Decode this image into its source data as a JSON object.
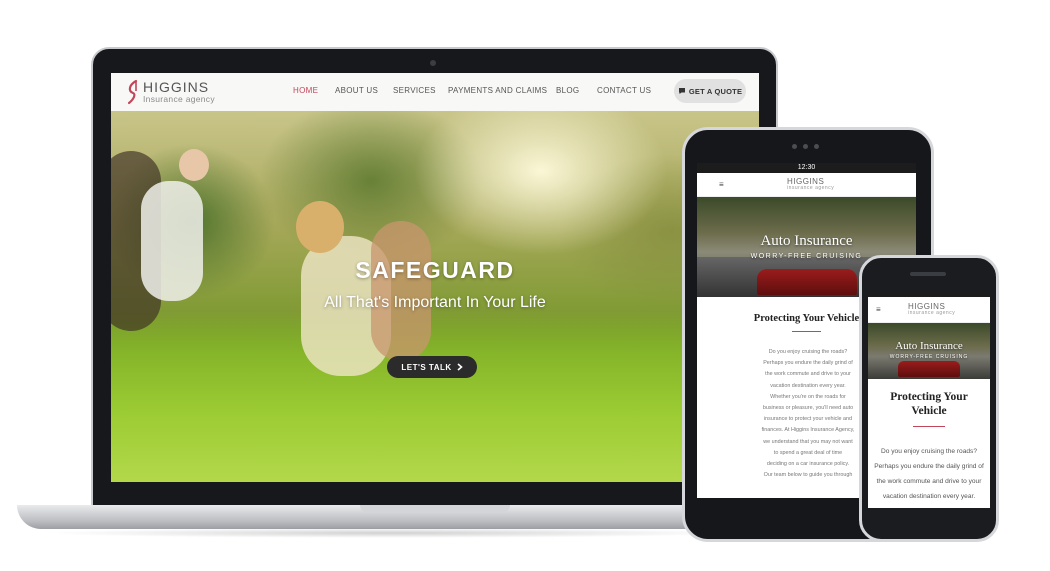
{
  "colors": {
    "accent": "#c2465a",
    "device_frame": "#16181b",
    "button_dark": "#2b2b2b"
  },
  "laptop": {
    "logo": {
      "name": "HIGGINS",
      "tagline": "Insurance agency"
    },
    "nav": [
      "HOME",
      "ABOUT US",
      "SERVICES",
      "PAYMENTS AND CLAIMS",
      "BLOG",
      "CONTACT US"
    ],
    "active_nav": "HOME",
    "cta": {
      "icon": "chat-bubble-icon",
      "label": "GET A QUOTE"
    },
    "hero": {
      "title": "SAFEGUARD",
      "subtitle": "All That's Important In Your Life",
      "button": "LET'S TALK"
    }
  },
  "tablet": {
    "status_time": "12:30",
    "menu_icon": "≡",
    "logo": {
      "name": "HIGGINS",
      "tagline": "insurance agency"
    },
    "hero": {
      "title": "Auto Insurance",
      "subtitle": "WORRY-FREE CRUISING"
    },
    "section_title": "Protecting Your Vehicle",
    "body_lines": [
      "Do you enjoy cruising the roads?",
      "Perhaps you endure the daily grind of",
      "the work commute and drive to your",
      "vacation destination every year.",
      "Whether you're on the roads for",
      "business or pleasure, you'll need auto",
      "insurance to protect your vehicle and",
      "finances. At Higgins Insurance Agency,",
      "we understand that you may not want",
      "to spend a great deal of time",
      "deciding on a car insurance policy.",
      "Our team below to guide you through"
    ]
  },
  "phone": {
    "menu_icon": "≡",
    "logo": {
      "name": "HIGGINS",
      "tagline": "insurance agency"
    },
    "hero": {
      "title": "Auto Insurance",
      "subtitle": "WORRY-FREE CRUISING"
    },
    "section_title": "Protecting Your Vehicle",
    "body_lines": [
      "Do you enjoy cruising the roads?",
      "Perhaps you endure the daily grind of",
      "the work commute and drive to your",
      "vacation destination every year."
    ]
  }
}
